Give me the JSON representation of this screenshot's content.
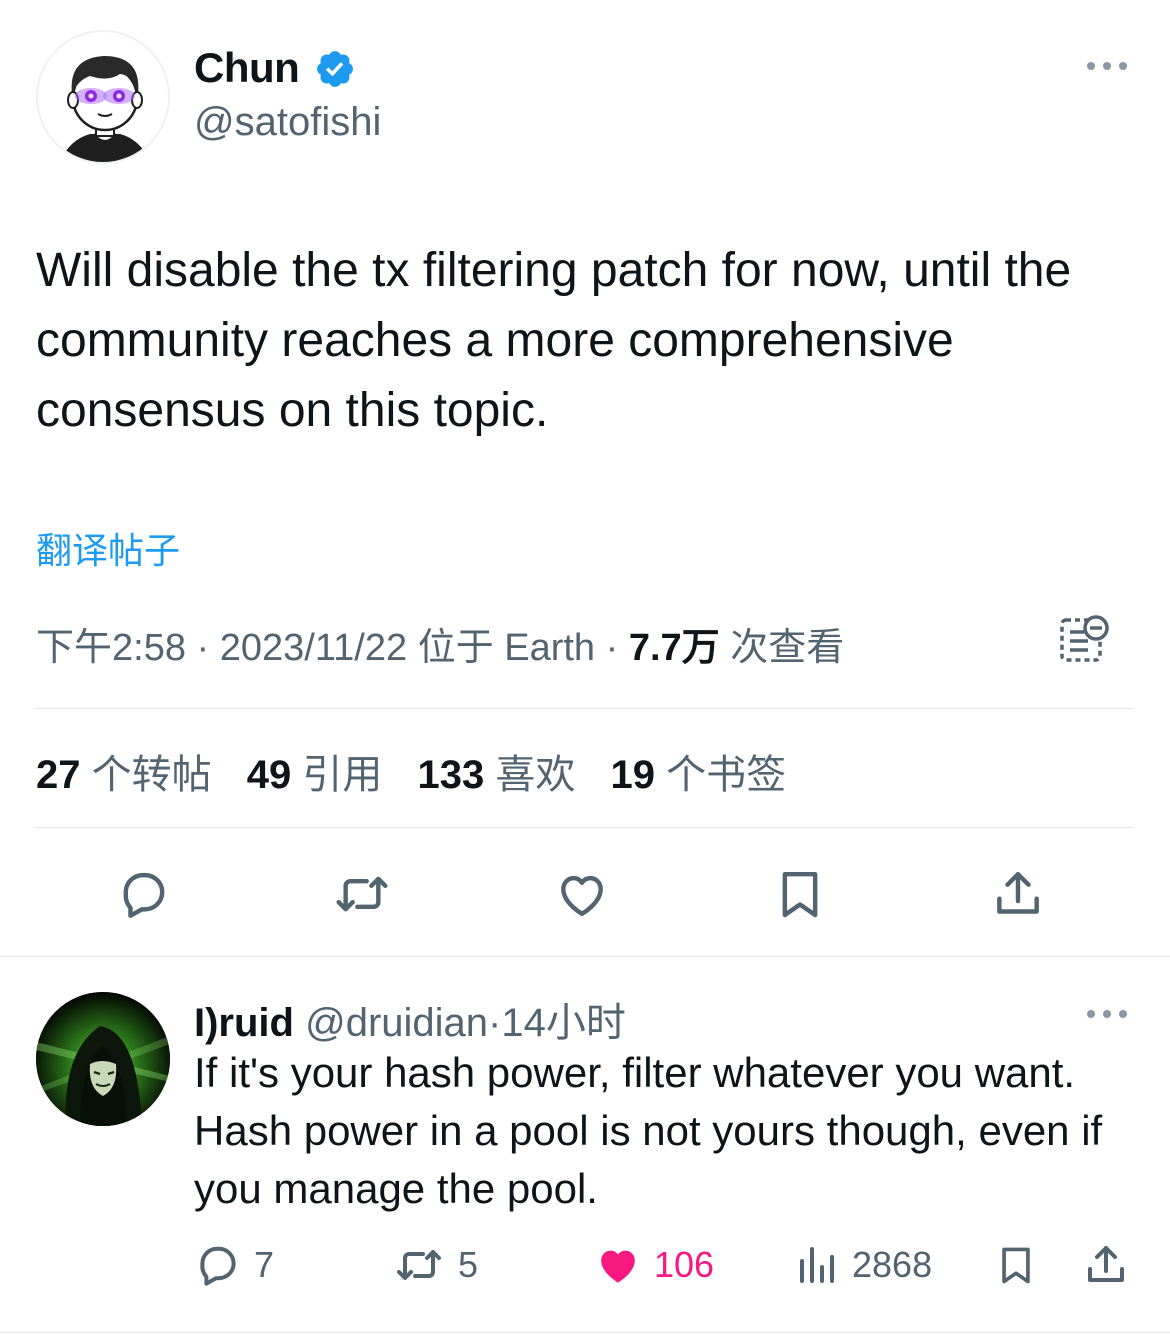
{
  "tweet": {
    "author_name": "Chun",
    "author_handle": "@satofishi",
    "verified": true,
    "text": "Will disable the tx filtering patch for now, until the community reaches a more comprehensive consensus on this topic.",
    "translate_label": "翻译帖子",
    "time": "下午2:58",
    "date": "2023/11/22",
    "location": "位于 Earth",
    "views_count": "7.7万",
    "views_label": "次查看",
    "separator": "·",
    "stats": {
      "retweets_count": "27",
      "retweets_label": "个转帖",
      "quotes_count": "49",
      "quotes_label": "引用",
      "likes_count": "133",
      "likes_label": "喜欢",
      "bookmarks_count": "19",
      "bookmarks_label": "个书签"
    },
    "icons": [
      "reply-icon",
      "retweet-icon",
      "like-icon",
      "bookmark-icon",
      "share-icon",
      "analytics-icon",
      "more-icon",
      "verified-badge-icon"
    ]
  },
  "reply": {
    "author_name": "I)ruid",
    "author_handle": "@druidian",
    "separator": "·",
    "time_ago": "14小时",
    "text": "If it's your hash power, filter whatever you want.  Hash power in a pool is not yours though, even if you manage the pool.",
    "reply_count": "7",
    "retweet_count": "5",
    "like_count": "106",
    "view_count": "2868",
    "liked": true
  },
  "colors": {
    "text_primary": "#0f1419",
    "text_secondary": "#536471",
    "link_blue": "#1d9bf0",
    "verified_blue": "#1d9bf0",
    "like_pink": "#f91880",
    "divider": "#e5e8eb"
  }
}
